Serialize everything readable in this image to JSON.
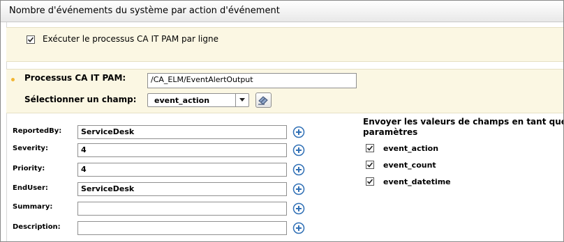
{
  "header": {
    "title": "Nombre d'événements du système par action d'événement"
  },
  "process_row": {
    "checkbox_checked": true,
    "label": "Exécuter le processus CA IT PAM par ligne"
  },
  "pam": {
    "process_label": "Processus CA IT PAM:",
    "process_value": "/CA_ELM/EventAlertOutput",
    "field_label": "Sélectionner un champ:",
    "field_value": "event_action"
  },
  "fields": [
    {
      "label": "ReportedBy:",
      "value": "ServiceDesk"
    },
    {
      "label": "Severity:",
      "value": "4"
    },
    {
      "label": "Priority:",
      "value": "4"
    },
    {
      "label": "EndUser:",
      "value": "ServiceDesk"
    },
    {
      "label": "Summary:",
      "value": ""
    },
    {
      "label": "Description:",
      "value": ""
    }
  ],
  "send_params": {
    "title_line1": "Envoyer les valeurs de champs en tant que",
    "title_line2": "paramètres",
    "items": [
      {
        "label": "event_action",
        "checked": true
      },
      {
        "label": "event_count",
        "checked": true
      },
      {
        "label": "event_datetime",
        "checked": true
      }
    ]
  },
  "colors": {
    "panel_bg": "#fbf7e3",
    "accent_dot": "#f2b632",
    "plus_blue": "#2f6fb5"
  }
}
